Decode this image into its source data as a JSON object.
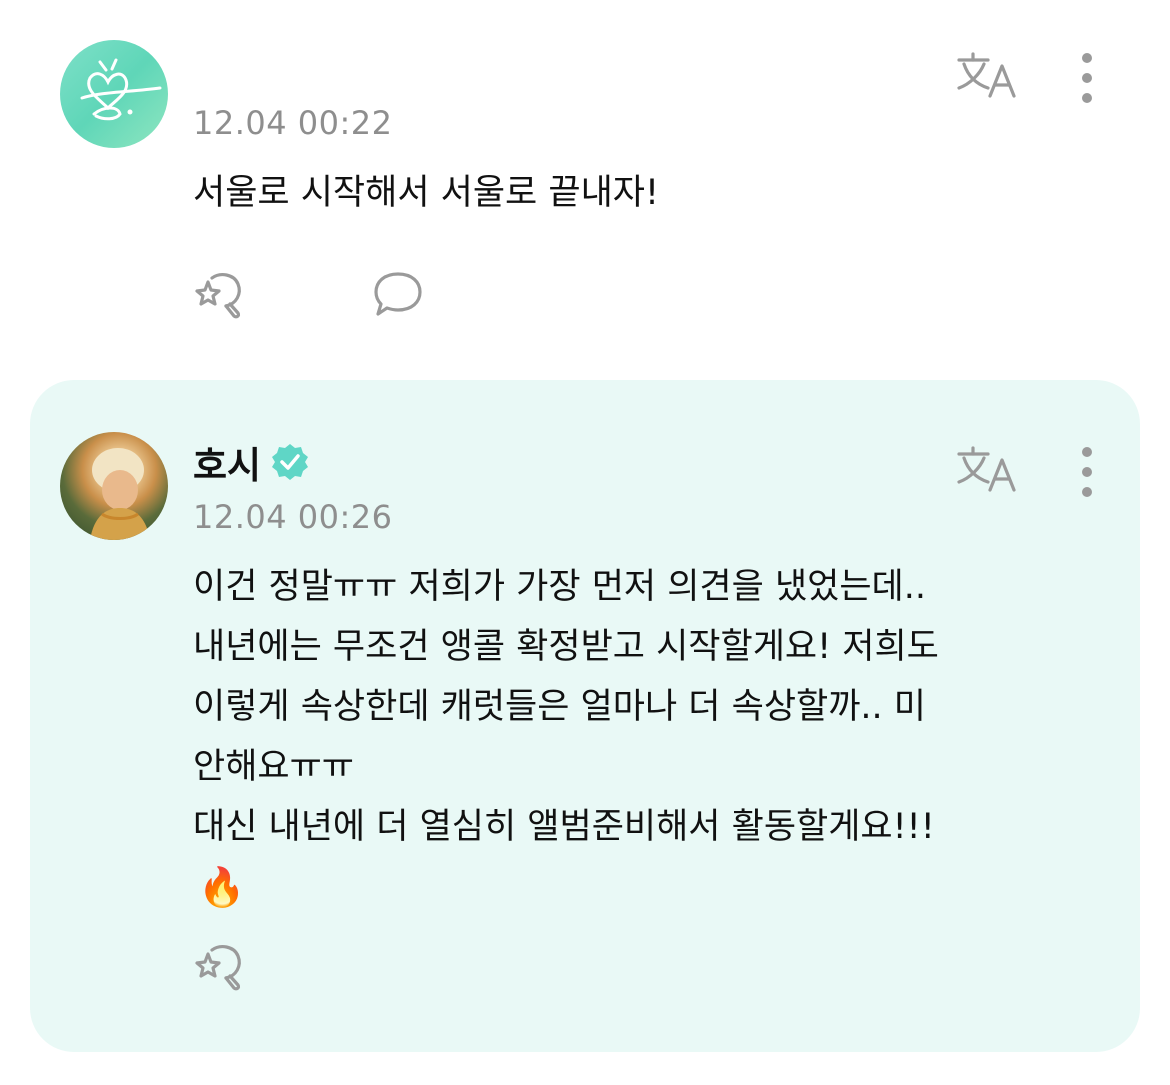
{
  "post": {
    "timestamp": "12.04 00:22",
    "message": "서울로 시작해서 서울로 끝내자!"
  },
  "reply": {
    "author": "호시",
    "timestamp": "12.04 00:26",
    "message": "이건 정말ㅠㅠ 저희가 가장 먼저 의견을 냈었는데..\n내년에는 무조건 앵콜 확정받고 시작할게요! 저희도\n이렇게 속상한데 캐럿들은 얼마나 더 속상할까.. 미\n안해요ㅠㅠ\n대신 내년에 더 열심히 앨범준비해서 활동할게요!!!",
    "emoji": "🔥"
  },
  "colors": {
    "card_background": "#e9f9f6",
    "icon_gray": "#9a9a9a",
    "verified_badge": "#5fd6c6",
    "timestamp_gray": "#8e8e8e"
  },
  "icons": {
    "translate": "translate-icon",
    "more": "more-vertical-icon",
    "reaction": "reaction-icon",
    "comment": "comment-icon",
    "verified": "verified-badge-icon"
  }
}
